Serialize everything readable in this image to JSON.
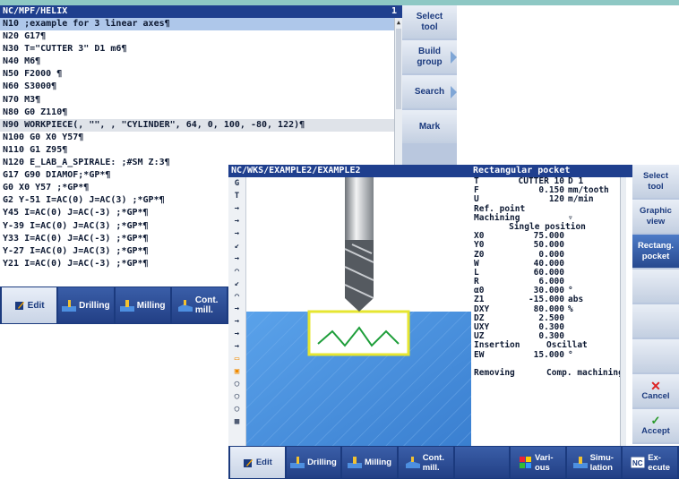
{
  "back_window": {
    "title": "NC/MPF/HELIX",
    "line_number": "1",
    "code_lines": [
      "N10 ;example for 3 linear axes¶",
      "N20 G17¶",
      "N30 T=\"CUTTER 3\" D1 m6¶",
      "N40 M6¶",
      "N50 F2000 ¶",
      "N60 S3000¶",
      "N70 M3¶",
      "N80 G0 Z110¶",
      "N90 WORKPIECE(, \"\", , \"CYLINDER\", 64, 0, 100, -80, 122)¶",
      "N100 G0 X0 Y57¶",
      "N110 G1 Z95¶",
      "N120 E_LAB_A_SPIRALE: ;#SM Z:3¶",
      "G17 G90 DIAMOF;*GP*¶",
      "G0 X0 Y57 ;*GP*¶",
      "G2 Y-51 I=AC(0) J=AC(3) ;*GP*¶",
      "Y45 I=AC(0) J=AC(-3) ;*GP*¶",
      "Y-39 I=AC(0) J=AC(3) ;*GP*¶",
      "Y33 I=AC(0) J=AC(-3) ;*GP*¶",
      "Y-27 I=AC(0) J=AC(3) ;*GP*¶",
      "Y21 I=AC(0) J=AC(-3) ;*GP*¶"
    ],
    "softkeys": {
      "edit": "Edit",
      "drilling": "Drilling",
      "milling": "Milling",
      "cont_mill": "Cont. mill."
    },
    "vertical_softkeys": {
      "select_tool": "Select tool",
      "build_group": "Build group",
      "search": "Search",
      "mark": "Mark"
    }
  },
  "front_window": {
    "title": "NC/WKS/EXAMPLE2/EXAMPLE2",
    "dialog_title": "Rectangular pocket",
    "icon_column": [
      "G",
      "T"
    ],
    "form": [
      {
        "k": "T",
        "v": "CUTTER 10",
        "u": "D 1"
      },
      {
        "k": "F",
        "v": "0.150",
        "u": "mm/tooth"
      },
      {
        "k": "U",
        "v": "120",
        "u": "m/min"
      },
      {
        "k": "Ref. point",
        "v": "",
        "u": ""
      },
      {
        "k": "Machining",
        "v": "",
        "u": "▿"
      },
      {
        "k": "",
        "v": "Single position",
        "u": ""
      },
      {
        "k": "X0",
        "v": "75.000",
        "u": ""
      },
      {
        "k": "Y0",
        "v": "50.000",
        "u": ""
      },
      {
        "k": "Z0",
        "v": "0.000",
        "u": ""
      },
      {
        "k": "W",
        "v": "40.000",
        "u": ""
      },
      {
        "k": "L",
        "v": "60.000",
        "u": ""
      },
      {
        "k": "R",
        "v": "6.000",
        "u": ""
      },
      {
        "k": "α0",
        "v": "30.000",
        "u": "°"
      },
      {
        "k": "Z1",
        "v": "-15.000",
        "u": "abs"
      },
      {
        "k": "DXY",
        "v": "80.000",
        "u": "%"
      },
      {
        "k": "DZ",
        "v": "2.500",
        "u": ""
      },
      {
        "k": "UXY",
        "v": "0.300",
        "u": ""
      },
      {
        "k": "UZ",
        "v": "0.300",
        "u": ""
      },
      {
        "k": "Insertion",
        "v": "",
        "u": "Oscillat"
      },
      {
        "k": "EW",
        "v": "15.000",
        "u": "°"
      },
      {
        "k": "",
        "v": "",
        "u": ""
      },
      {
        "k": "Removing",
        "v": "",
        "u": "Comp. machining"
      }
    ],
    "vertical_softkeys": {
      "select_tool": "Select tool",
      "graphic_view": "Graphic view",
      "rectang_pocket": "Rectang. pocket",
      "cancel": "Cancel",
      "accept": "Accept"
    },
    "softkeys": {
      "edit": "Edit",
      "drilling": "Drilling",
      "milling": "Milling",
      "cont_mill": "Cont. mill.",
      "various": "Vari- ous",
      "simulation": "Simu- lation",
      "execute": "Ex- ecute"
    },
    "colors": {
      "title_bar": "#1f3f8e",
      "workpiece": "#4a90e0",
      "pocket_outline": "#e6e630",
      "helix": "#1e9e3a"
    }
  }
}
